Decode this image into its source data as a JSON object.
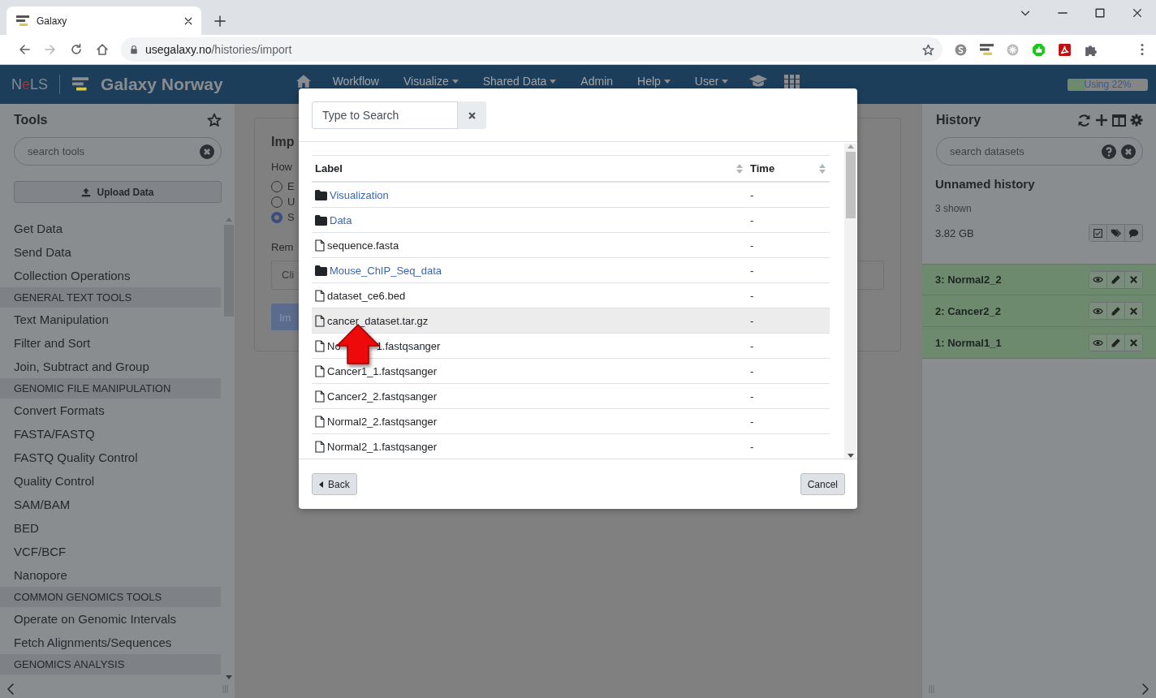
{
  "browser": {
    "tab_title": "Galaxy",
    "url_host": "usegalaxy.no",
    "url_path": "/histories/import"
  },
  "navbar": {
    "nels_logo": [
      {
        "text": "N",
        "accent": false
      },
      {
        "text": "e",
        "accent": true
      },
      {
        "text": "LS",
        "accent": false
      }
    ],
    "brand": "Galaxy Norway",
    "items": [
      {
        "label": "Workflow",
        "dropdown": false
      },
      {
        "label": "Visualize",
        "dropdown": true
      },
      {
        "label": "Shared Data",
        "dropdown": true
      },
      {
        "label": "Admin",
        "dropdown": false
      },
      {
        "label": "Help",
        "dropdown": true
      },
      {
        "label": "User",
        "dropdown": true
      }
    ],
    "quota": {
      "label": "Using 22%",
      "level": 0.22
    }
  },
  "tool_panel": {
    "title": "Tools",
    "search": {
      "placeholder": "search tools"
    },
    "upload_button": "Upload Data",
    "items": [
      {
        "kind": "tool",
        "label": "Get Data"
      },
      {
        "kind": "tool",
        "label": "Send Data"
      },
      {
        "kind": "tool",
        "label": "Collection Operations"
      },
      {
        "kind": "section",
        "label": "GENERAL TEXT TOOLS"
      },
      {
        "kind": "tool",
        "label": "Text Manipulation"
      },
      {
        "kind": "tool",
        "label": "Filter and Sort"
      },
      {
        "kind": "tool",
        "label": "Join, Subtract and Group"
      },
      {
        "kind": "section",
        "label": "GENOMIC FILE MANIPULATION"
      },
      {
        "kind": "tool",
        "label": "Convert Formats"
      },
      {
        "kind": "tool",
        "label": "FASTA/FASTQ"
      },
      {
        "kind": "tool",
        "label": "FASTQ Quality Control"
      },
      {
        "kind": "tool",
        "label": "Quality Control"
      },
      {
        "kind": "tool",
        "label": "SAM/BAM"
      },
      {
        "kind": "tool",
        "label": "BED"
      },
      {
        "kind": "tool",
        "label": "VCF/BCF"
      },
      {
        "kind": "tool",
        "label": "Nanopore"
      },
      {
        "kind": "section",
        "label": "COMMON GENOMICS TOOLS"
      },
      {
        "kind": "tool",
        "label": "Operate on Genomic Intervals"
      },
      {
        "kind": "tool",
        "label": "Fetch Alignments/Sequences"
      },
      {
        "kind": "section",
        "label": "GENOMICS ANALYSIS"
      }
    ]
  },
  "center_panel": {
    "title": "Imp",
    "prompt": "How",
    "radios": [
      {
        "label": "E",
        "selected": false
      },
      {
        "label": "U",
        "selected": false
      },
      {
        "label": "S",
        "selected": true
      }
    ],
    "remote_label": "Rem",
    "url_field": {
      "placeholder": "Cli"
    },
    "import_button": "Im"
  },
  "history_panel": {
    "title": "History",
    "search": {
      "placeholder": "search datasets"
    },
    "name": "Unnamed history",
    "shown": "3 shown",
    "size": "3.82 GB",
    "datasets": [
      {
        "label": "3: Normal2_2"
      },
      {
        "label": "2: Cancer2_2"
      },
      {
        "label": "1: Normal1_1"
      }
    ]
  },
  "modal": {
    "search": {
      "placeholder": "Type to Search"
    },
    "columns": [
      "Label",
      "Time"
    ],
    "rows": [
      {
        "kind": "folder",
        "label": "Visualization",
        "time": "-",
        "selected": false
      },
      {
        "kind": "folder",
        "label": "Data",
        "time": "-",
        "selected": false
      },
      {
        "kind": "file",
        "label": "sequence.fasta",
        "time": "-",
        "selected": false
      },
      {
        "kind": "folder",
        "label": "Mouse_ChIP_Seq_data",
        "time": "-",
        "selected": false
      },
      {
        "kind": "file",
        "label": "dataset_ce6.bed",
        "time": "-",
        "selected": false
      },
      {
        "kind": "file",
        "label": "cancer_dataset.tar.gz",
        "time": "-",
        "selected": true
      },
      {
        "kind": "file",
        "label_parts": [
          "No",
          "1.fastqsanger"
        ],
        "time": "-",
        "selected": false
      },
      {
        "kind": "file",
        "label": "Cancer1_1.fastqsanger",
        "time": "-",
        "selected": false
      },
      {
        "kind": "file",
        "label": "Cancer2_2.fastqsanger",
        "time": "-",
        "selected": false
      },
      {
        "kind": "file",
        "label": "Normal2_2.fastqsanger",
        "time": "-",
        "selected": false
      },
      {
        "kind": "file",
        "label": "Normal2_1.fastqsanger",
        "time": "-",
        "selected": false
      }
    ],
    "back_button": "Back",
    "cancel_button": "Cancel"
  }
}
